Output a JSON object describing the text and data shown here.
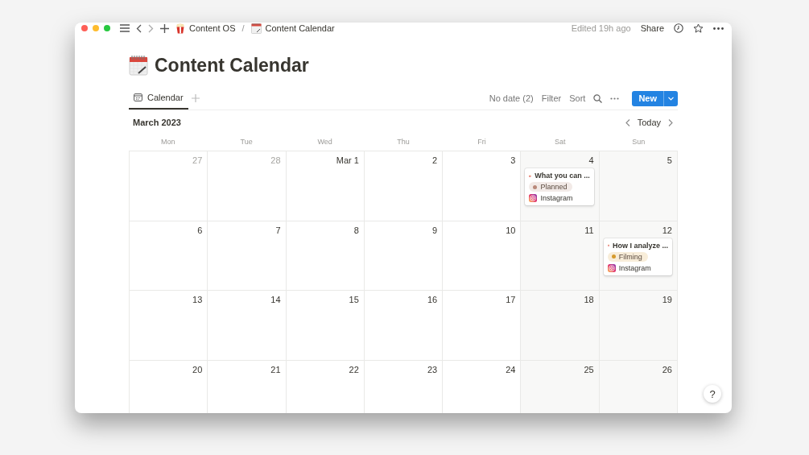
{
  "titlebar": {
    "breadcrumbs": [
      {
        "label": "Content OS"
      },
      {
        "label": "Content Calendar"
      }
    ],
    "separator": "/",
    "edited": "Edited 19h ago",
    "share": "Share"
  },
  "page": {
    "title": "Content Calendar"
  },
  "views": [
    {
      "label": "Calendar",
      "selected": true
    }
  ],
  "toolbar": {
    "no_date": "No date (2)",
    "filter": "Filter",
    "sort": "Sort",
    "new": "New"
  },
  "calendar": {
    "month": "March 2023",
    "today": "Today",
    "weekdays": [
      {
        "label": "Mon"
      },
      {
        "label": "Tue"
      },
      {
        "label": "Wed"
      },
      {
        "label": "Thu"
      },
      {
        "label": "Fri"
      },
      {
        "label": "Sat"
      },
      {
        "label": "Sun"
      }
    ],
    "weeks": [
      [
        {
          "day": "27",
          "in_month": false
        },
        {
          "day": "28",
          "in_month": false
        },
        {
          "day": "Mar 1",
          "in_month": true
        },
        {
          "day": "2",
          "in_month": true
        },
        {
          "day": "3",
          "in_month": true
        },
        {
          "day": "4",
          "in_month": true,
          "events": [
            {
              "title": "What you can ...",
              "status": {
                "label": "Planned",
                "color": "#b9897a"
              },
              "platform": "Instagram"
            }
          ]
        },
        {
          "day": "5",
          "in_month": true
        }
      ],
      [
        {
          "day": "6",
          "in_month": true
        },
        {
          "day": "7",
          "in_month": true
        },
        {
          "day": "8",
          "in_month": true
        },
        {
          "day": "9",
          "in_month": true
        },
        {
          "day": "10",
          "in_month": true
        },
        {
          "day": "11",
          "in_month": true
        },
        {
          "day": "12",
          "in_month": true,
          "events": [
            {
              "title": "How I analyze ...",
              "status": {
                "label": "Filming",
                "color": "#d69b2e"
              },
              "platform": "Instagram"
            }
          ]
        }
      ],
      [
        {
          "day": "13",
          "in_month": true
        },
        {
          "day": "14",
          "in_month": true
        },
        {
          "day": "15",
          "in_month": true
        },
        {
          "day": "16",
          "in_month": true
        },
        {
          "day": "17",
          "in_month": true
        },
        {
          "day": "18",
          "in_month": true
        },
        {
          "day": "19",
          "in_month": true
        }
      ],
      [
        {
          "day": "20",
          "in_month": true
        },
        {
          "day": "21",
          "in_month": true
        },
        {
          "day": "22",
          "in_month": true
        },
        {
          "day": "23",
          "in_month": true
        },
        {
          "day": "24",
          "in_month": true
        },
        {
          "day": "25",
          "in_month": true
        },
        {
          "day": "26",
          "in_month": true
        }
      ]
    ]
  },
  "help": "?"
}
